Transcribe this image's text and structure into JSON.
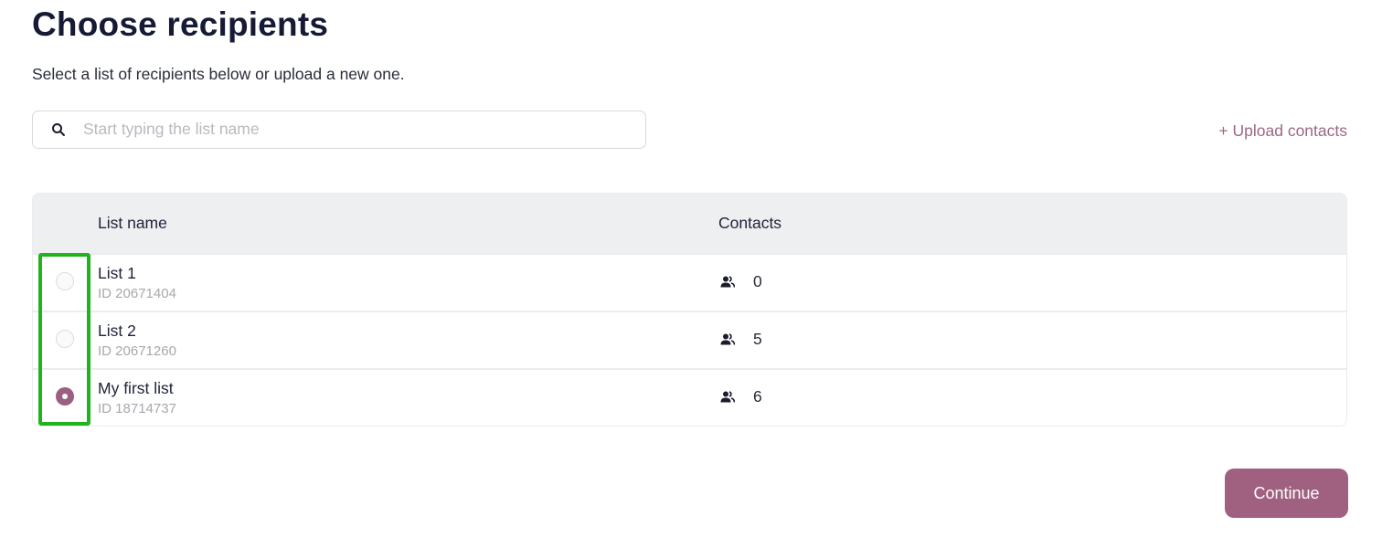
{
  "page": {
    "title": "Choose recipients",
    "subtitle": "Select a list of recipients below or upload a new one."
  },
  "search": {
    "placeholder": "Start typing the list name",
    "value": "",
    "icon": "search-icon"
  },
  "upload_link": "+ Upload contacts",
  "table": {
    "columns": [
      "List name",
      "Contacts"
    ],
    "rows": [
      {
        "name": "List 1",
        "id": "ID 20671404",
        "contacts": "0",
        "selected": false
      },
      {
        "name": "List 2",
        "id": "ID 20671260",
        "contacts": "5",
        "selected": false
      },
      {
        "name": "My first list",
        "id": "ID 18714737",
        "contacts": "6",
        "selected": true
      }
    ],
    "contacts_icon": "people-icon"
  },
  "continue_button": "Continue",
  "colors": {
    "accent": "#a0607f",
    "link": "#9b6882",
    "highlight": "#1fb41c"
  }
}
